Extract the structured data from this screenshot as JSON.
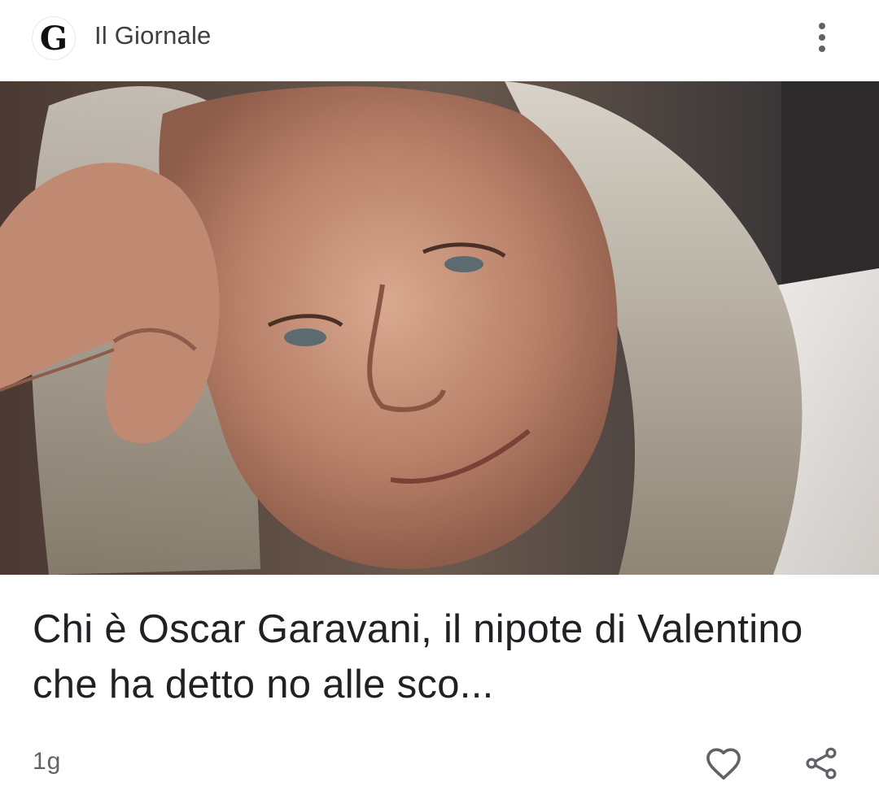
{
  "header": {
    "logo_letter": "G",
    "publisher": "Il Giornale",
    "more_icon": "more-vert-icon"
  },
  "article": {
    "image_subject": "Photo of a smiling man with long grey hair resting his head on his hand",
    "headline": "Chi è Oscar Garavani, il nipote di Valentino che ha detto no alle sco...",
    "age": "1g"
  },
  "actions": {
    "like_icon": "heart-icon",
    "share_icon": "share-icon"
  },
  "colors": {
    "text_primary": "#202124",
    "text_secondary": "#5f6368",
    "icon": "#5f6368",
    "background": "#ffffff"
  }
}
